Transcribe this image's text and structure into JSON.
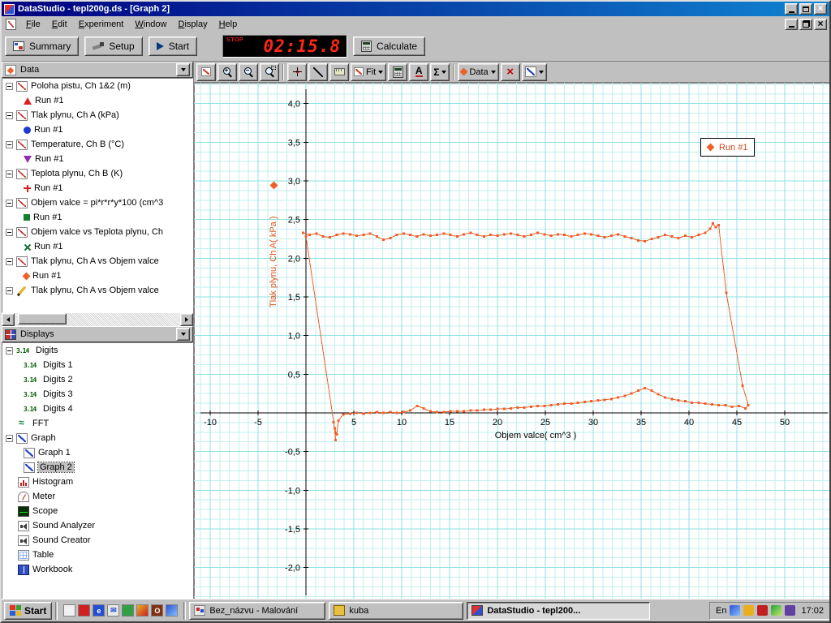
{
  "window": {
    "title": "DataStudio - tepl200g.ds - [Graph 2]"
  },
  "menu": {
    "items": [
      "File",
      "Edit",
      "Experiment",
      "Window",
      "Display",
      "Help"
    ]
  },
  "toolbar": {
    "summary": "Summary",
    "setup": "Setup",
    "start": "Start",
    "stop_label": "STOP",
    "timer": "02:15.8",
    "calculate": "Calculate"
  },
  "graph_toolbar": {
    "fit": "Fit",
    "data": "Data",
    "stats": "Σ",
    "text": "A"
  },
  "data_panel": {
    "title": "Data",
    "items": [
      {
        "label": "Poloha pistu, Ch 1&2 (m)",
        "run": "Run #1",
        "marker": "red-triangle"
      },
      {
        "label": "Tlak plynu, Ch A (kPa)",
        "run": "Run #1",
        "marker": "blue-circle"
      },
      {
        "label": "Temperature, Ch B (°C)",
        "run": "Run #1",
        "marker": "purple-triangle"
      },
      {
        "label": "Teplota plynu, Ch B (K)",
        "run": "Run #1",
        "marker": "red-plus"
      },
      {
        "label": "Objem valce = pi*r*r*y*100 (cm^3",
        "run": "Run #1",
        "marker": "green-square"
      },
      {
        "label": "Objem valce vs Teplota plynu, Ch",
        "run": "Run #1",
        "marker": "green-x"
      },
      {
        "label": "Tlak plynu, Ch A vs Objem valce",
        "run": "Run #1",
        "marker": "orange-diamond"
      },
      {
        "label": "Tlak plynu, Ch A vs Objem valce",
        "run": null,
        "marker": "pencil"
      }
    ]
  },
  "displays_panel": {
    "title": "Displays",
    "items": [
      {
        "label": "Digits",
        "type": "digits",
        "depth": 0
      },
      {
        "label": "Digits 1",
        "type": "digits",
        "depth": 1
      },
      {
        "label": "Digits 2",
        "type": "digits",
        "depth": 1
      },
      {
        "label": "Digits 3",
        "type": "digits",
        "depth": 1
      },
      {
        "label": "Digits 4",
        "type": "digits",
        "depth": 1
      },
      {
        "label": "FFT",
        "type": "fft",
        "depth": 0
      },
      {
        "label": "Graph",
        "type": "graph",
        "depth": 0
      },
      {
        "label": "Graph 1",
        "type": "graph",
        "depth": 1
      },
      {
        "label": "Graph 2",
        "type": "graph",
        "depth": 1,
        "selected": true
      },
      {
        "label": "Histogram",
        "type": "histogram",
        "depth": 0
      },
      {
        "label": "Meter",
        "type": "meter",
        "depth": 0
      },
      {
        "label": "Scope",
        "type": "scope",
        "depth": 0
      },
      {
        "label": "Sound Analyzer",
        "type": "sound",
        "depth": 0
      },
      {
        "label": "Sound Creator",
        "type": "sound",
        "depth": 0
      },
      {
        "label": "Table",
        "type": "table",
        "depth": 0
      },
      {
        "label": "Workbook",
        "type": "workbook",
        "depth": 0
      }
    ]
  },
  "chart_data": {
    "type": "scatter",
    "xlabel": "Objem valce( cm^3 )",
    "ylabel": "Tlak plynu, Ch A( kPa )",
    "legend": "Run #1",
    "series_color": "#ef6028",
    "grid_minor": "#c2efef",
    "grid_major": "#8fe2e2",
    "xlim": [
      -11.7,
      55.0
    ],
    "ylim": [
      -2.45,
      4.27
    ],
    "x_ticks": [
      -10,
      -5,
      5,
      10,
      15,
      20,
      25,
      30,
      35,
      40,
      45,
      50
    ],
    "x_tick_labels": [
      "-10",
      "-5",
      "5",
      "10",
      "15",
      "20",
      "25",
      "30",
      "35",
      "40",
      "45",
      "50"
    ],
    "y_ticks": [
      4.0,
      3.5,
      3.0,
      2.5,
      2.0,
      1.5,
      1.0,
      0.5,
      -0.5,
      -1.0,
      -1.5,
      -2.0
    ],
    "y_tick_labels": [
      "4,0",
      "3,5",
      "3,0",
      "2,5",
      "2,0",
      "1,5",
      "1,0",
      "0,5",
      "-0,5",
      "-1,0",
      "-1,5",
      "-2,0"
    ],
    "series": [
      {
        "name": "Run #1",
        "points": [
          [
            -0.3,
            2.33
          ],
          [
            0.4,
            2.3
          ],
          [
            1.1,
            2.32
          ],
          [
            1.8,
            2.28
          ],
          [
            2.5,
            2.27
          ],
          [
            3.2,
            2.3
          ],
          [
            3.9,
            2.32
          ],
          [
            4.6,
            2.31
          ],
          [
            5.3,
            2.29
          ],
          [
            6.0,
            2.3
          ],
          [
            6.7,
            2.32
          ],
          [
            7.4,
            2.28
          ],
          [
            8.1,
            2.24
          ],
          [
            8.8,
            2.26
          ],
          [
            9.5,
            2.3
          ],
          [
            10.2,
            2.32
          ],
          [
            10.9,
            2.3
          ],
          [
            11.6,
            2.28
          ],
          [
            12.3,
            2.31
          ],
          [
            13.0,
            2.29
          ],
          [
            13.7,
            2.3
          ],
          [
            14.4,
            2.32
          ],
          [
            15.1,
            2.3
          ],
          [
            15.8,
            2.28
          ],
          [
            16.5,
            2.31
          ],
          [
            17.2,
            2.33
          ],
          [
            17.9,
            2.3
          ],
          [
            18.6,
            2.28
          ],
          [
            19.3,
            2.3
          ],
          [
            20.0,
            2.29
          ],
          [
            20.7,
            2.31
          ],
          [
            21.4,
            2.32
          ],
          [
            22.1,
            2.3
          ],
          [
            22.8,
            2.28
          ],
          [
            23.5,
            2.3
          ],
          [
            24.2,
            2.33
          ],
          [
            24.9,
            2.31
          ],
          [
            25.6,
            2.29
          ],
          [
            26.3,
            2.31
          ],
          [
            27.0,
            2.3
          ],
          [
            27.7,
            2.28
          ],
          [
            28.4,
            2.3
          ],
          [
            29.1,
            2.32
          ],
          [
            29.8,
            2.31
          ],
          [
            30.5,
            2.29
          ],
          [
            31.2,
            2.27
          ],
          [
            31.9,
            2.29
          ],
          [
            32.6,
            2.31
          ],
          [
            33.3,
            2.28
          ],
          [
            34.0,
            2.26
          ],
          [
            34.7,
            2.23
          ],
          [
            35.4,
            2.22
          ],
          [
            36.1,
            2.25
          ],
          [
            36.8,
            2.27
          ],
          [
            37.5,
            2.3
          ],
          [
            38.2,
            2.28
          ],
          [
            38.9,
            2.26
          ],
          [
            39.6,
            2.29
          ],
          [
            40.3,
            2.27
          ],
          [
            41.0,
            2.3
          ],
          [
            41.7,
            2.33
          ],
          [
            42.2,
            2.38
          ],
          [
            42.5,
            2.45
          ],
          [
            42.8,
            2.4
          ],
          [
            43.1,
            2.43
          ],
          [
            43.9,
            1.55
          ],
          [
            45.6,
            0.35
          ],
          [
            46.2,
            0.1
          ],
          [
            45.9,
            0.06
          ],
          [
            45.2,
            0.09
          ],
          [
            44.5,
            0.08
          ],
          [
            43.8,
            0.1
          ],
          [
            43.1,
            0.1
          ],
          [
            42.4,
            0.11
          ],
          [
            41.7,
            0.12
          ],
          [
            41.0,
            0.13
          ],
          [
            40.3,
            0.13
          ],
          [
            39.6,
            0.15
          ],
          [
            38.9,
            0.16
          ],
          [
            38.2,
            0.18
          ],
          [
            37.5,
            0.2
          ],
          [
            36.8,
            0.24
          ],
          [
            36.1,
            0.29
          ],
          [
            35.4,
            0.32
          ],
          [
            34.7,
            0.29
          ],
          [
            34.0,
            0.25
          ],
          [
            33.3,
            0.22
          ],
          [
            32.6,
            0.2
          ],
          [
            31.9,
            0.18
          ],
          [
            31.2,
            0.17
          ],
          [
            30.5,
            0.16
          ],
          [
            29.8,
            0.15
          ],
          [
            29.1,
            0.14
          ],
          [
            28.4,
            0.13
          ],
          [
            27.7,
            0.12
          ],
          [
            27.0,
            0.12
          ],
          [
            26.3,
            0.11
          ],
          [
            25.6,
            0.1
          ],
          [
            24.9,
            0.09
          ],
          [
            24.2,
            0.09
          ],
          [
            23.5,
            0.08
          ],
          [
            22.8,
            0.07
          ],
          [
            22.1,
            0.07
          ],
          [
            21.4,
            0.06
          ],
          [
            20.7,
            0.05
          ],
          [
            20.0,
            0.05
          ],
          [
            19.3,
            0.04
          ],
          [
            18.6,
            0.04
          ],
          [
            17.9,
            0.03
          ],
          [
            17.2,
            0.03
          ],
          [
            16.5,
            0.02
          ],
          [
            15.8,
            0.02
          ],
          [
            15.1,
            0.02
          ],
          [
            14.4,
            0.01
          ],
          [
            13.7,
            0.01
          ],
          [
            13.0,
            0.02
          ],
          [
            12.3,
            0.06
          ],
          [
            11.6,
            0.09
          ],
          [
            10.9,
            0.03
          ],
          [
            10.2,
            0.01
          ],
          [
            9.5,
            0.0
          ],
          [
            8.8,
            0.01
          ],
          [
            8.1,
            0.0
          ],
          [
            7.4,
            0.01
          ],
          [
            6.7,
            0.0
          ],
          [
            6.0,
            -0.01
          ],
          [
            5.3,
            0.0
          ],
          [
            4.6,
            -0.01
          ],
          [
            3.9,
            -0.02
          ],
          [
            3.4,
            -0.1
          ],
          [
            3.2,
            -0.28
          ],
          [
            3.0,
            -0.2
          ],
          [
            3.1,
            -0.35
          ],
          [
            2.9,
            -0.12
          ],
          [
            0.0,
            2.28
          ]
        ]
      }
    ]
  },
  "taskbar": {
    "start": "Start",
    "tasks": [
      {
        "label": "Bez_názvu - Malování"
      },
      {
        "label": "kuba"
      },
      {
        "label": "DataStudio - tepl200..."
      }
    ],
    "language": "En",
    "clock": "17:02"
  }
}
